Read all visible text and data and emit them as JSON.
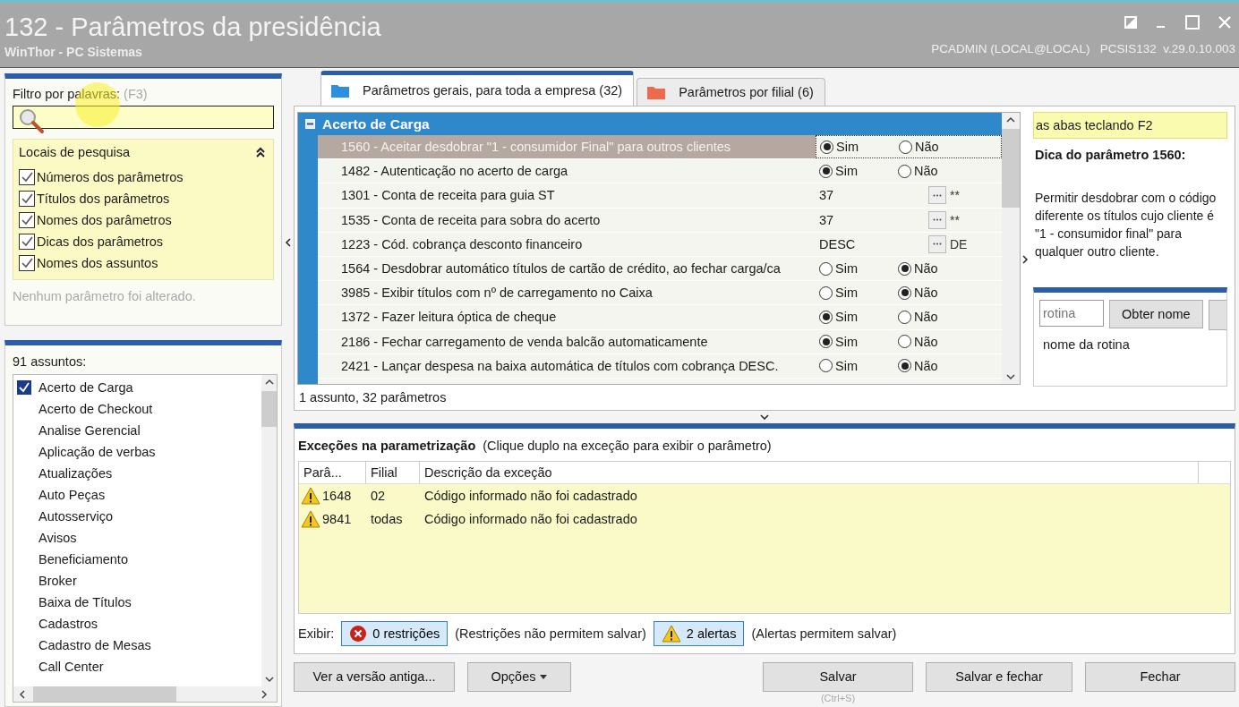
{
  "window": {
    "title": "132 - Parâmetros da presidência",
    "app": "WinThor - PC Sistemas",
    "session": "PCADMIN (LOCAL@LOCAL)   PCSIS132  v.29.0.10.003"
  },
  "filter": {
    "label": "Filtro por palavras:",
    "shortcut": "(F3)",
    "locations_title": "Locais de pesquisa",
    "expanded": true,
    "locations": [
      {
        "label": "Números dos parâmetros",
        "checked": true
      },
      {
        "label": "Títulos dos parâmetros",
        "checked": true
      },
      {
        "label": "Nomes dos parâmetros",
        "checked": true
      },
      {
        "label": "Dicas dos parâmetros",
        "checked": true
      },
      {
        "label": "Nomes dos assuntos",
        "checked": true
      }
    ],
    "status": "Nenhum parâmetro foi alterado."
  },
  "subjects": {
    "count": "91 assuntos:",
    "items": [
      {
        "label": "Acerto de Carga",
        "checked": true
      },
      {
        "label": "Acerto de Checkout",
        "checked": false
      },
      {
        "label": "Analise Gerencial",
        "checked": false
      },
      {
        "label": "Aplicação de verbas",
        "checked": false
      },
      {
        "label": "Atualizações",
        "checked": false
      },
      {
        "label": "Auto Peças",
        "checked": false
      },
      {
        "label": "Autosserviço",
        "checked": false
      },
      {
        "label": "Avisos",
        "checked": false
      },
      {
        "label": "Beneficiamento",
        "checked": false
      },
      {
        "label": "Broker",
        "checked": false
      },
      {
        "label": "Baixa de Títulos",
        "checked": false
      },
      {
        "label": "Cadastros",
        "checked": false
      },
      {
        "label": "Cadastro de Mesas",
        "checked": false
      },
      {
        "label": "Call Center",
        "checked": false
      }
    ]
  },
  "tabs": [
    {
      "label": "Parâmetros gerais, para toda a empresa  (32)",
      "selected": true,
      "color": "#2d8fe0"
    },
    {
      "label": "Parâmetros por filial  (6)",
      "selected": false,
      "color": "#ee6a4c"
    }
  ],
  "grid": {
    "group": "Acerto de Carga",
    "expanded": true,
    "rows": [
      {
        "kind": "yesno",
        "label": "1560 - Aceitar desdobrar \"1 - consumidor Final\" para outros clientes",
        "selected": true,
        "options": [
          {
            "label": "Sim",
            "selected": true
          },
          {
            "label": "Não",
            "selected": false
          }
        ]
      },
      {
        "kind": "yesno",
        "label": "1482 - Autenticação no acerto de carga",
        "selected": false,
        "options": [
          {
            "label": "Sim",
            "selected": true
          },
          {
            "label": "Não",
            "selected": false
          }
        ]
      },
      {
        "kind": "lookup",
        "label": "1301 - Conta de receita para guia ST",
        "selected": false,
        "value": "37",
        "extra": "**"
      },
      {
        "kind": "lookup",
        "label": "1535 - Conta de receita para sobra do acerto",
        "selected": false,
        "value": "37",
        "extra": "**"
      },
      {
        "kind": "lookup",
        "label": "1223 - Cód. cobrança desconto financeiro",
        "selected": false,
        "value": "DESC",
        "extra": "DE"
      },
      {
        "kind": "yesno",
        "label": "1564 - Desdobrar automático títulos de cartão de crédito, ao fechar carga/ca",
        "selected": false,
        "options": [
          {
            "label": "Sim",
            "selected": false
          },
          {
            "label": "Não",
            "selected": true
          }
        ]
      },
      {
        "kind": "yesno",
        "label": "3985 - Exibir títulos com nº de carregamento no Caixa",
        "selected": false,
        "options": [
          {
            "label": "Sim",
            "selected": false
          },
          {
            "label": "Não",
            "selected": true
          }
        ]
      },
      {
        "kind": "yesno",
        "label": "1372 - Fazer leitura óptica de cheque",
        "selected": false,
        "options": [
          {
            "label": "Sim",
            "selected": true
          },
          {
            "label": "Não",
            "selected": false
          }
        ]
      },
      {
        "kind": "yesno",
        "label": "2186 - Fechar carregamento de venda balcão automaticamente",
        "selected": false,
        "options": [
          {
            "label": "Sim",
            "selected": true
          },
          {
            "label": "Não",
            "selected": false
          }
        ]
      },
      {
        "kind": "yesno",
        "label": "2421 - Lançar despesa na baixa automática de títulos com cobrança DESC.",
        "selected": false,
        "options": [
          {
            "label": "Sim",
            "selected": false
          },
          {
            "label": "Não",
            "selected": true
          }
        ]
      }
    ],
    "status": "1 assunto, 32 parâmetros"
  },
  "hint": {
    "banner": "as abas teclando F2",
    "title": "Dica do parâmetro 1560:",
    "text": "Permitir desdobrar com o código diferente os títulos cujo cliente é \"1 - consumidor final\" para qualquer outro cliente."
  },
  "routine": {
    "placeholder": "rotina",
    "button": "Obter nome",
    "result": "nome da rotina"
  },
  "exceptions": {
    "title": "Exceções na parametrização",
    "subtitle": "(Clique duplo na exceção para exibir o parâmetro)",
    "columns": [
      "Parâ...",
      "Filial",
      "Descrição da exceção"
    ],
    "rows": [
      {
        "param": "1648",
        "branch": "02",
        "description": "Código informado não foi cadastrado"
      },
      {
        "param": "9841",
        "branch": "todas",
        "description": "Código informado não foi cadastrado"
      }
    ],
    "show_label": "Exibir:",
    "toggles": [
      {
        "kind": "error",
        "label": "0 restrições",
        "note": "(Restrições não permitem salvar)",
        "selected": true
      },
      {
        "kind": "warning",
        "label": "2 alertas",
        "note": "(Alertas permitem salvar)",
        "selected": true
      }
    ]
  },
  "buttons": {
    "old_version": "Ver a versão antiga...",
    "options": "Opções",
    "save": "Salvar",
    "save_shortcut": "(Ctrl+S)",
    "save_close": "Salvar e fechar",
    "close": "Fechar"
  }
}
